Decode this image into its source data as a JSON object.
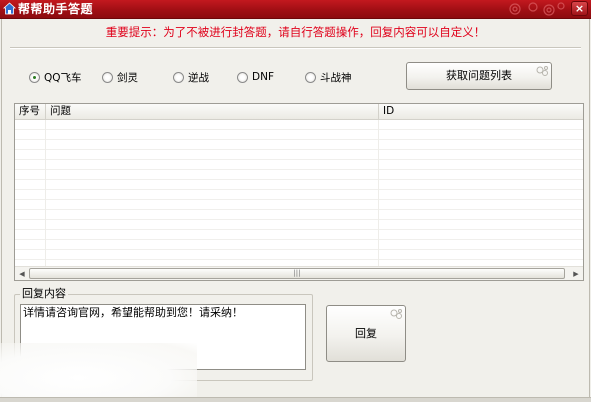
{
  "window": {
    "title": "帮帮助手答题",
    "close_label": "×"
  },
  "notice": "重要提示：为了不被进行封答题，请自行答题操作，回复内容可以自定义！",
  "games": [
    {
      "label": "QQ飞车",
      "selected": true
    },
    {
      "label": "剑灵",
      "selected": false
    },
    {
      "label": "逆战",
      "selected": false
    },
    {
      "label": "DNF",
      "selected": false
    },
    {
      "label": "斗战神",
      "selected": false
    }
  ],
  "fetch_button": "获取问题列表",
  "table": {
    "columns": [
      "序号",
      "问题",
      "ID"
    ],
    "rows": []
  },
  "reply": {
    "group_label": "回复内容",
    "text": "详情请咨询官网，希望能帮助到您！请采纳！",
    "button": "回复"
  },
  "colors": {
    "titlebar": "#a10f14",
    "notice_text": "#e0001a",
    "window_bg": "#f1f0eb"
  },
  "icons": [
    "app-house-icon",
    "title-swirl-decoration-icon",
    "close-icon",
    "button-corner-swirl-icon",
    "scroll-left-arrow-icon",
    "scroll-right-arrow-icon"
  ]
}
